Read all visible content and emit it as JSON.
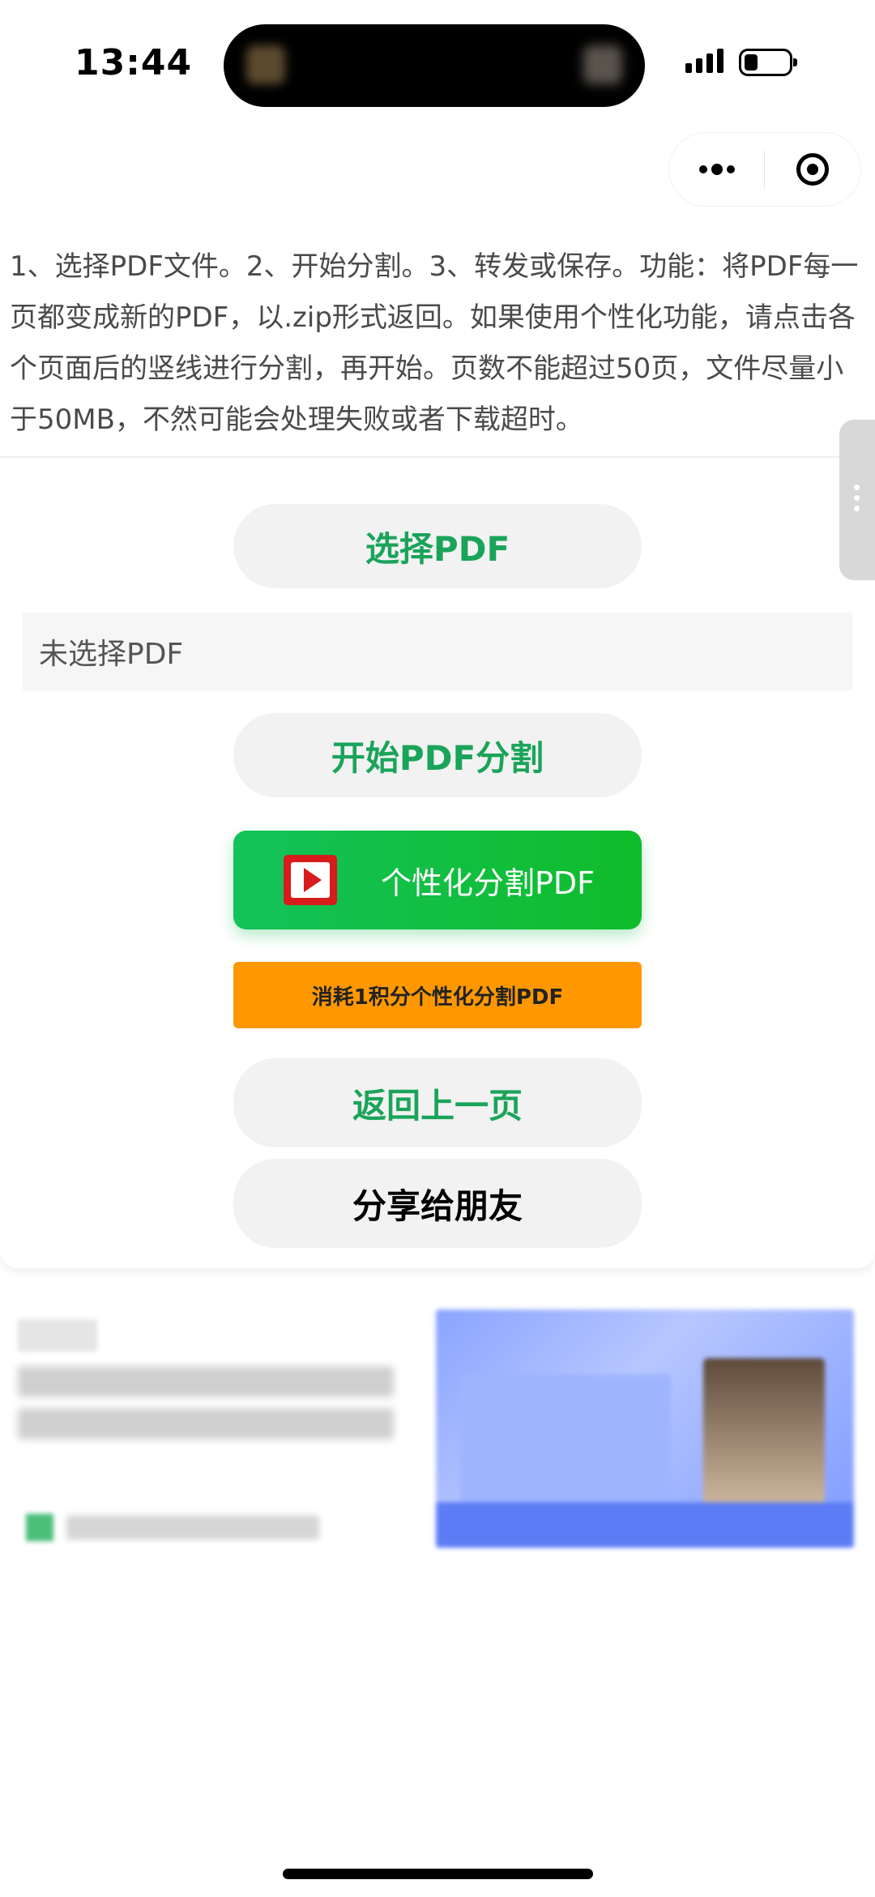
{
  "status_bar": {
    "time": "13:44"
  },
  "description": "1、选择PDF文件。2、开始分割。3、转发或保存。功能：将PDF每一页都变成新的PDF，以.zip形式返回。如果使用个性化功能，请点击各个页面后的竖线进行分割，再开始。页数不能超过50页，文件尽量小于50MB，不然可能会处理失败或者下载超时。",
  "buttons": {
    "select_pdf": "选择PDF",
    "start_split": "开始PDF分割",
    "custom_split": "个性化分割PDF",
    "points_custom_split": "消耗1积分个性化分割PDF",
    "back": "返回上一页",
    "share": "分享给朋友"
  },
  "file_status": "未选择PDF",
  "colors": {
    "accent_green": "#1aa45a",
    "custom_button_green": "#14c25a",
    "points_orange": "#ff9800"
  },
  "icons": [
    "more-icon",
    "target-icon",
    "video-play-icon"
  ]
}
